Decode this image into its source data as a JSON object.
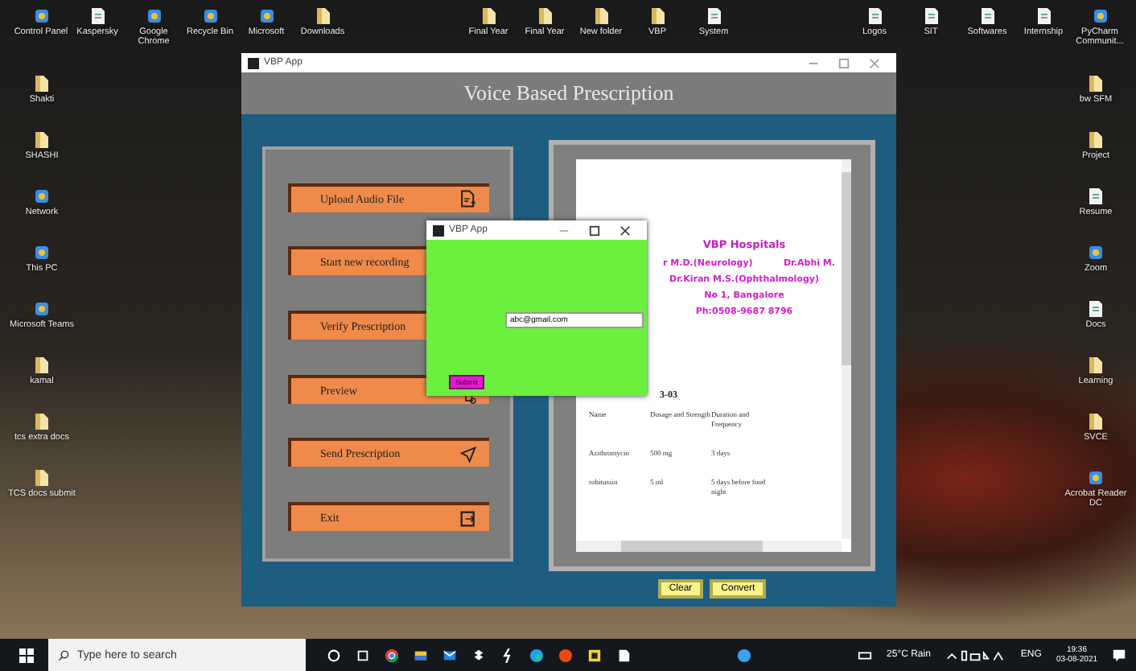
{
  "desktop": {
    "top_left_icons": [
      {
        "label": "Control Panel",
        "kind": "app"
      },
      {
        "label": "Kaspersky",
        "kind": "doc"
      },
      {
        "label": "Google Chrome",
        "kind": "app"
      },
      {
        "label": "Recycle Bin",
        "kind": "app"
      },
      {
        "label": "Microsoft",
        "kind": "app"
      },
      {
        "label": "Downloads",
        "kind": "folder"
      }
    ],
    "top_middle_icons": [
      {
        "label": "Final Year",
        "kind": "folder"
      },
      {
        "label": "Final Year",
        "kind": "folder"
      },
      {
        "label": "New folder",
        "kind": "folder"
      },
      {
        "label": "VBP",
        "kind": "folder"
      },
      {
        "label": "System",
        "kind": "doc"
      }
    ],
    "top_right_icons": [
      {
        "label": "Logos",
        "kind": "doc"
      },
      {
        "label": "SIT",
        "kind": "doc"
      },
      {
        "label": "Softwares",
        "kind": "doc"
      },
      {
        "label": "Internship",
        "kind": "doc"
      },
      {
        "label": "PyCharm Communit...",
        "kind": "app"
      }
    ],
    "left_icons": [
      {
        "label": "Shakti",
        "kind": "folder"
      },
      {
        "label": "SHASHI",
        "kind": "folder"
      },
      {
        "label": "Network",
        "kind": "app"
      },
      {
        "label": "This PC",
        "kind": "app"
      },
      {
        "label": "Microsoft Teams",
        "kind": "app"
      },
      {
        "label": "kamal",
        "kind": "folder"
      },
      {
        "label": "tcs extra docs",
        "kind": "folder"
      },
      {
        "label": "TCS docs submit",
        "kind": "folder"
      }
    ],
    "right_icons": [
      {
        "label": "bw SFM",
        "kind": "folder"
      },
      {
        "label": "Project",
        "kind": "folder"
      },
      {
        "label": "Resume",
        "kind": "doc"
      },
      {
        "label": "Zoom",
        "kind": "app"
      },
      {
        "label": "Docs",
        "kind": "doc"
      },
      {
        "label": "Learning",
        "kind": "folder"
      },
      {
        "label": "SVCE",
        "kind": "folder"
      },
      {
        "label": "Acrobat Reader DC",
        "kind": "app"
      }
    ]
  },
  "window": {
    "title": "VBP App",
    "header": "Voice Based Prescription",
    "buttons": [
      {
        "label": "Upload Audio File",
        "kind": "upload"
      },
      {
        "label": "Start new recording",
        "kind": "plain"
      },
      {
        "label": "Verify Prescription",
        "kind": "plain"
      },
      {
        "label": "Preview",
        "kind": "preview"
      },
      {
        "label": "Send Prescription",
        "kind": "send"
      },
      {
        "label": "Exit",
        "kind": "exit"
      }
    ],
    "document": {
      "hospital": "VBP Hospitals",
      "doctor_left": "r M.D.(Neurology)",
      "doctor_right": "Dr.Abhi M.",
      "lines": [
        "Dr.Kiran M.S.(Ophthalmology)",
        "No 1, Bangalore",
        "Ph:0508-9687 8796"
      ],
      "date": "3-03",
      "table": [
        [
          "Name",
          "Dosage and Strength",
          "Duration and Frequency"
        ],
        [
          "Azithromycin",
          "500 mg",
          "3 days"
        ],
        [
          "robitussin",
          "5 ml",
          "5 days before food night"
        ]
      ]
    },
    "actions": [
      "Clear",
      "Convert"
    ]
  },
  "dialog": {
    "title": "VBP App",
    "email": "abc@gmail.com",
    "submit": "Submit"
  },
  "taskbar": {
    "search_placeholder": "Type here to search",
    "weather": "25°C  Rain",
    "language": "ENG",
    "time": "19:36",
    "date": "03-08-2021"
  }
}
